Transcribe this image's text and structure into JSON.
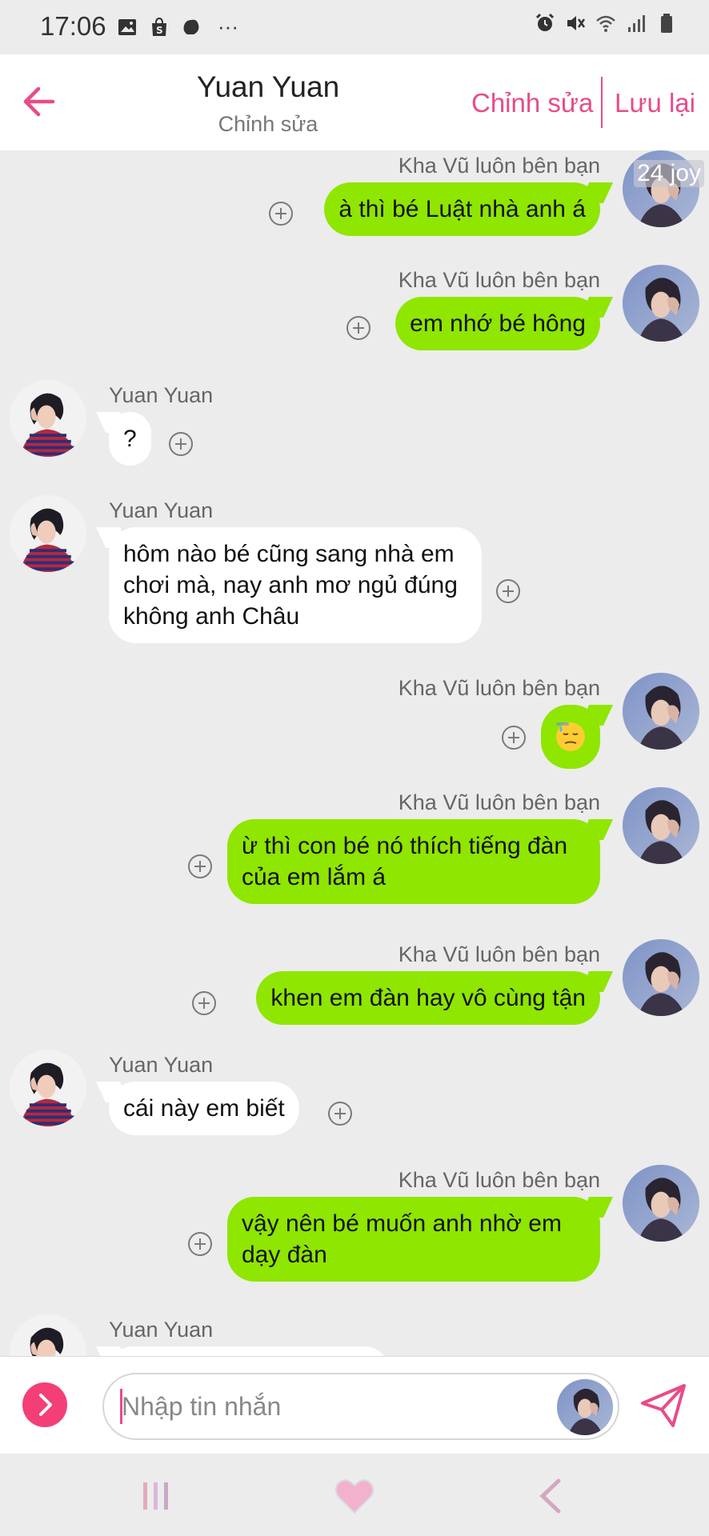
{
  "status_bar": {
    "time": "17:06",
    "more": "···"
  },
  "header": {
    "title": "Yuan Yuan",
    "subtitle": "Chỉnh sửa",
    "edit_label": "Chỉnh sửa",
    "save_label": "Lưu lại",
    "accent": "#e84b8a"
  },
  "joy_badge": "24 joy",
  "messages": [
    {
      "sender": "Kha Vũ luôn bên bạn",
      "side": "me",
      "text": "à thì bé Luật nhà anh á"
    },
    {
      "sender": "Kha Vũ luôn bên bạn",
      "side": "me",
      "text": "em nhớ bé hông"
    },
    {
      "sender": "Yuan Yuan",
      "side": "other",
      "text": "?"
    },
    {
      "sender": "Yuan Yuan",
      "side": "other",
      "text": "hôm nào bé cũng sang nhà em chơi mà, nay anh mơ ngủ đúng không anh Châu"
    },
    {
      "sender": "Kha Vũ luôn bên bạn",
      "side": "me",
      "text": "",
      "emoji": "sweat-face"
    },
    {
      "sender": "Kha Vũ luôn bên bạn",
      "side": "me",
      "text": "ừ thì con bé nó thích tiếng đàn của em lắm á"
    },
    {
      "sender": "Kha Vũ luôn bên bạn",
      "side": "me",
      "text": "khen em đàn hay vô cùng tận"
    },
    {
      "sender": "Yuan Yuan",
      "side": "other",
      "text": "cái này em biết"
    },
    {
      "sender": "Kha Vũ luôn bên bạn",
      "side": "me",
      "text": "vậy nên bé muốn anh nhờ em dạy đàn"
    },
    {
      "sender": "Yuan Yuan",
      "side": "other",
      "text": ""
    }
  ],
  "input": {
    "placeholder": "Nhập tin nhắn"
  },
  "colors": {
    "my_bubble": "#8fe600",
    "other_bubble": "#ffffff",
    "background": "#ececec",
    "send_toggle": "#f43f76"
  }
}
